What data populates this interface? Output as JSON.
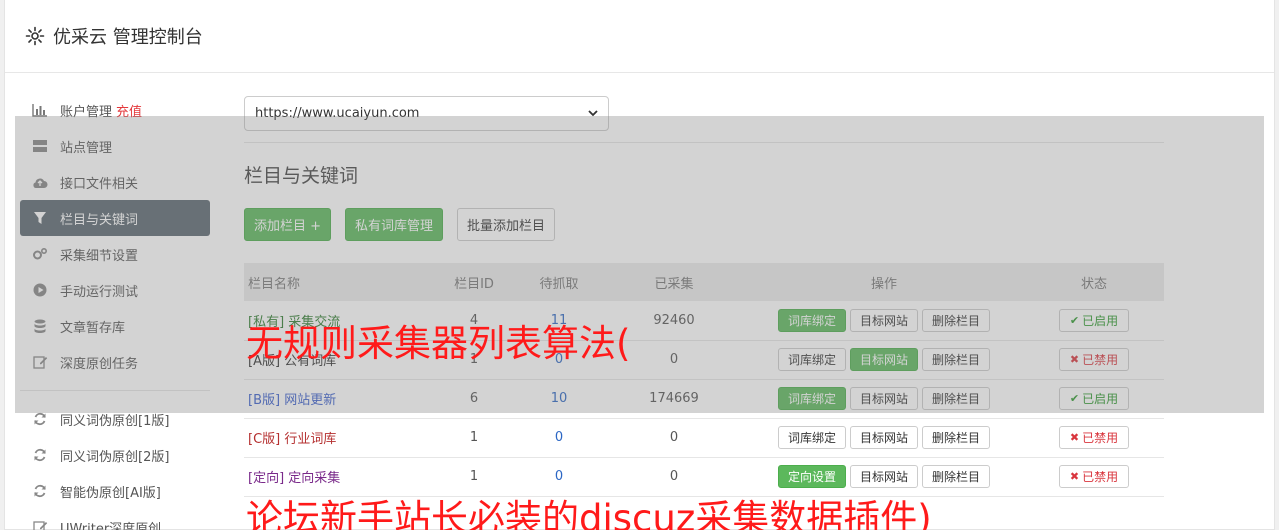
{
  "header": {
    "title": "优采云 管理控制台"
  },
  "sidebar": {
    "items": [
      {
        "label": "账户管理",
        "extra": "充值",
        "icon": "bar-chart-icon"
      },
      {
        "label": "站点管理",
        "icon": "server-icon"
      },
      {
        "label": "接口文件相关",
        "icon": "cloud-upload-icon"
      },
      {
        "label": "栏目与关键词",
        "icon": "filter-icon",
        "active": true
      },
      {
        "label": "采集细节设置",
        "icon": "cogs-icon"
      },
      {
        "label": "手动运行测试",
        "icon": "play-circle-icon"
      },
      {
        "label": "文章暂存库",
        "icon": "database-icon"
      },
      {
        "label": "深度原创任务",
        "icon": "edit-icon"
      }
    ],
    "items2": [
      {
        "label": "同义词伪原创[1版]",
        "icon": "refresh-icon"
      },
      {
        "label": "同义词伪原创[2版]",
        "icon": "refresh-icon"
      },
      {
        "label": "智能伪原创[AI版]",
        "icon": "refresh-icon"
      },
      {
        "label": "UWriter深度原创",
        "icon": "edit-icon"
      }
    ]
  },
  "main": {
    "site_select": "https://www.ucaiyun.com",
    "section_title": "栏目与关键词",
    "buttons": {
      "add": "添加栏目 +",
      "private_lib": "私有词库管理",
      "batch_add": "批量添加栏目"
    },
    "table": {
      "headers": [
        "栏目名称",
        "栏目ID",
        "待抓取",
        "已采集",
        "操作",
        "状态"
      ],
      "rows": [
        {
          "tag": "[私有]",
          "name": "采集交流",
          "id": "4",
          "pending": "11",
          "collected": "92460",
          "op1": "词库绑定",
          "op2": "目标网站",
          "op3": "删除栏目",
          "status": "已启用"
        },
        {
          "tag": "[A版]",
          "name": "公有词库",
          "id": "1",
          "pending": "0",
          "collected": "0",
          "op1": "词库绑定",
          "op2": "目标网站",
          "op3": "删除栏目",
          "status": "已禁用"
        },
        {
          "tag": "[B版]",
          "name": "网站更新",
          "id": "6",
          "pending": "10",
          "collected": "174669",
          "op1": "词库绑定",
          "op2": "目标网站",
          "op3": "删除栏目",
          "status": "已启用"
        },
        {
          "tag": "[C版]",
          "name": "行业词库",
          "id": "1",
          "pending": "0",
          "collected": "0",
          "op1": "词库绑定",
          "op2": "目标网站",
          "op3": "删除栏目",
          "status": "已禁用"
        },
        {
          "tag": "[定向]",
          "name": "定向采集",
          "id": "1",
          "pending": "0",
          "collected": "0",
          "op1": "定向设置",
          "op2": "目标网站",
          "op3": "删除栏目",
          "status": "已禁用"
        }
      ]
    }
  },
  "overlay_text": {
    "line1": "无规则采集器列表算法(",
    "line2": "论坛新手站长必装的discuz采集数据插件)"
  },
  "colors": {
    "accent_green": "#5cb85c",
    "active_nav": "#5b6770",
    "caption_red": "#ff1a1a"
  }
}
